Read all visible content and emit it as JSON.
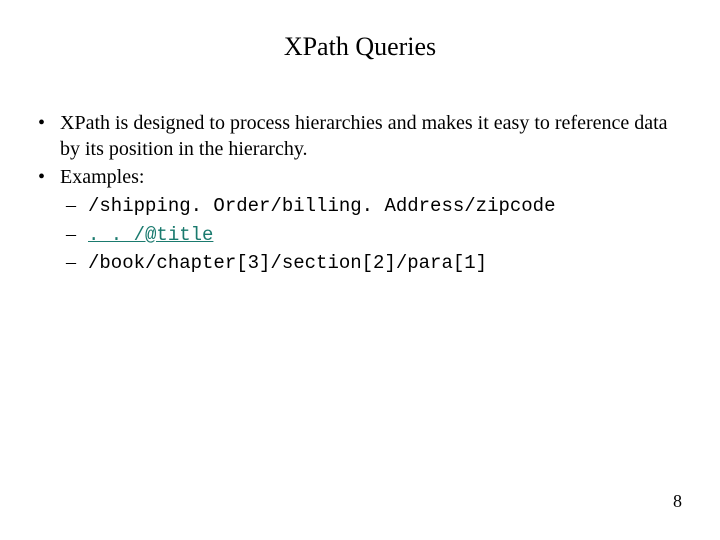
{
  "title": "XPath Queries",
  "bullets": {
    "item1": "XPath is designed to process hierarchies and makes it easy to reference data by its position in the hierarchy.",
    "item2": "Examples:",
    "examples": {
      "ex1": "/shipping. Order/billing. Address/zipcode",
      "ex2": ". . /@title",
      "ex3": "/book/chapter[3]/section[2]/para[1]"
    }
  },
  "pageNumber": "8"
}
